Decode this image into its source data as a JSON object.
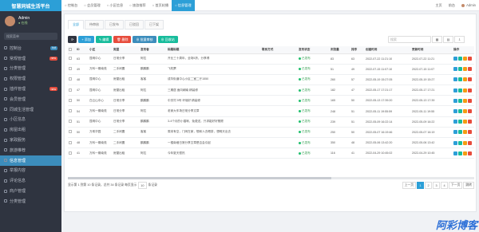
{
  "brand": "智慧同城生活平台",
  "user": {
    "name": "Admin",
    "status": "● 在线"
  },
  "sidebar_search": "搜索菜单",
  "menu": [
    {
      "label": "控制台",
      "badge": "hot",
      "badge_color": "#3c8dbc"
    },
    {
      "label": "常规管理",
      "badge": "new",
      "badge_color": "#e74c3c"
    },
    {
      "label": "分类管理",
      "badge": "",
      "badge_color": ""
    },
    {
      "label": "权限管理",
      "badge": "",
      "badge_color": ""
    },
    {
      "label": "插件管理",
      "badge": "new",
      "badge_color": "#e74c3c"
    },
    {
      "label": "会员管理",
      "badge": "",
      "badge_color": ""
    },
    {
      "label": "同城生活管理",
      "badge": "",
      "badge_color": ""
    },
    {
      "label": "小区信息",
      "badge": "",
      "badge_color": ""
    },
    {
      "label": "房屋出租",
      "badge": "",
      "badge_color": ""
    },
    {
      "label": "家政服务",
      "badge": "",
      "badge_color": ""
    },
    {
      "label": "旅游推荐",
      "badge": "",
      "badge_color": ""
    },
    {
      "label": "信息管理",
      "badge": "",
      "badge_color": "",
      "active": true
    },
    {
      "label": "举报内容",
      "badge": "",
      "badge_color": ""
    },
    {
      "label": "评论信息",
      "badge": "",
      "badge_color": ""
    },
    {
      "label": "商户管理",
      "badge": "",
      "badge_color": ""
    },
    {
      "label": "分类管理",
      "badge": "",
      "badge_color": ""
    }
  ],
  "topbar": {
    "tabs": [
      "控制台",
      "会员管理",
      "小区信息",
      "旅游推荐",
      "首页轮播",
      "信息管理"
    ],
    "home": "主页",
    "frontend": "前台",
    "user": "Admin"
  },
  "panel": {
    "tabs": [
      "全部",
      "待审核",
      "已发布",
      "已驳回",
      "已下架"
    ],
    "buttons": [
      {
        "label": "⟳",
        "color": "#2f3440"
      },
      {
        "label": "+ 添加",
        "color": "#2c9fd7"
      },
      {
        "label": "✎ 编辑",
        "color": "#18bc9c"
      },
      {
        "label": "🗑 删除",
        "color": "#e74c3c"
      },
      {
        "label": "⊕ 批量审核",
        "color": "#3c8dbc"
      },
      {
        "label": "⊕ 回收站",
        "color": "#18bc9c"
      }
    ],
    "search_placeholder": "搜索"
  },
  "table": {
    "headers": [
      "",
      "ID",
      "小区",
      "类型",
      "发布者",
      "标题标题",
      "联系方式",
      "发布状态",
      "浏览量",
      "排序",
      "创建时间",
      "更新时间",
      "操作"
    ],
    "rows": [
      [
        "",
        "63",
        "昆明中心",
        "日常分享",
        "阿拉",
        "开业三十周年，全场5折，分享得",
        "",
        "已发布",
        "83",
        "63",
        "2022-07-22 11:21:10",
        "2022-07-22 11:21"
      ],
      [
        "",
        "49",
        "万科一期南苑",
        "二手闲置",
        "鹏鹏鹏",
        "飞机票",
        "",
        "已发布",
        "51",
        "49",
        "2022-07-15 11:07:10",
        "2022-07-15 11:07"
      ],
      [
        "",
        "48",
        "昆明中心",
        "房屋出租",
        "客客",
        "成华街道中心小区二室二厅1550",
        "",
        "已发布",
        "260",
        "57",
        "2022-05-19 15:27:05",
        "2022-05-19 15:27"
      ],
      [
        "",
        "47",
        "昆明中心",
        "房屋出租",
        "阿拉",
        "三期居 面向朝南 精装修",
        "",
        "已发布",
        "182",
        "47",
        "2022-05-17 17:21:17",
        "2022-05-17 17:21"
      ],
      [
        "",
        "50",
        "白云山中心",
        "日常分享",
        "鹏鹏鹏",
        "中关村 5号 环境好 精装修",
        "",
        "已发布",
        "165",
        "50",
        "2022-05-13 17:39:20",
        "2022-05-13 17:39"
      ],
      [
        "",
        "54",
        "万科一期南苑",
        "日常分享",
        "阿拉",
        "老家大车场日常分享文章",
        "",
        "已发布",
        "248",
        "51",
        "2022-05-11 19:55:59",
        "2022-05-11 19:55"
      ],
      [
        "",
        "51",
        "昆明中心",
        "日常分享",
        "鹏鹏鹏",
        "3-4个月的小猫咪，免费送，只求能好好照顾",
        "",
        "已发布",
        "239",
        "51",
        "2022-05-09 16:22:14",
        "2022-05-09 16:22"
      ],
      [
        "",
        "50",
        "万希华园",
        "二手闲置",
        "客客",
        "周末有空，门闲在家，想和人去喝茶，想明天出去",
        "",
        "已发布",
        "250",
        "50",
        "2022-05-07 16:19:46",
        "2022-05-07 16:19"
      ],
      [
        "",
        "48",
        "万科一期南苑",
        "二手闲置",
        "鹏鹏鹏",
        "一楼南墙日常分享文章是否会引起",
        "",
        "已发布",
        "350",
        "48",
        "2022-05-06 13:42:20",
        "2022-05-06 13:42"
      ],
      [
        "",
        "41",
        "万科一期南苑",
        "房屋出租",
        "阿拉",
        "今年夏天很热",
        "",
        "已发布",
        "116",
        "41",
        "2022-04-29 10:45:02",
        "2022-04-29 10:45"
      ]
    ],
    "ops_colors": [
      "#2c9fd7",
      "#18bc9c",
      "#f39c12",
      "#e74c3c"
    ]
  },
  "footer": {
    "summary": "显示第 1 到第 10 条记录，总共 34 条记录 每页显示",
    "per_page": "10",
    "per_page_suffix": "条记录",
    "pages": [
      "上一页",
      "1",
      "2",
      "3",
      "4",
      "下一页",
      "跳转"
    ]
  },
  "watermark": "阿彩博客"
}
